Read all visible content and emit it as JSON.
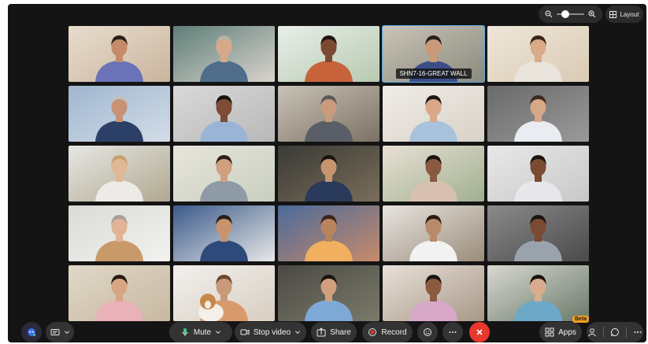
{
  "top_controls": {
    "zoom_level": 0.3,
    "layout_label": "Layout"
  },
  "participants": [
    {
      "shirt": "#6b72b8",
      "skin": "#c48a6a",
      "hair": "#2a1e18",
      "bg": [
        "#e9dccd",
        "#c9b59e"
      ]
    },
    {
      "shirt": "#4f6d8a",
      "skin": "#d6a98a",
      "hair": "#b8b0a8",
      "bg": [
        "#5e7e78",
        "#d9d4cc"
      ]
    },
    {
      "shirt": "#c8643c",
      "skin": "#7a4a32",
      "hair": "#1d1410",
      "bg": [
        "#e8efe9",
        "#b8c9b0"
      ]
    },
    {
      "shirt": "#3b4e8a",
      "skin": "#c89a7a",
      "hair": "#2a201a",
      "bg": [
        "#c9c4b8",
        "#8a8a7c"
      ],
      "room": "SHN7-16-GREAT WALL"
    },
    {
      "shirt": "#e9e4dc",
      "skin": "#d9aa88",
      "hair": "#3a2418",
      "bg": [
        "#efe6d8",
        "#d9cbb4"
      ]
    },
    {
      "shirt": "#2c3f66",
      "skin": "#c89274",
      "hair": "#c0c0c0",
      "bg": [
        "#9fb6cf",
        "#d3dde8"
      ]
    },
    {
      "shirt": "#9ab4d6",
      "skin": "#7c4c34",
      "hair": "#1a1410",
      "bg": [
        "#d9d9d9",
        "#b8b8b8"
      ]
    },
    {
      "shirt": "#5a5e66",
      "skin": "#c99a7c",
      "hair": "#5a5a5a",
      "bg": [
        "#c9c2b6",
        "#7c7264"
      ]
    },
    {
      "shirt": "#a9c2dc",
      "skin": "#d8a888",
      "hair": "#1e1612",
      "bg": [
        "#f0ece6",
        "#d8d2c8"
      ]
    },
    {
      "shirt": "#e9ecf0",
      "skin": "#d6a888",
      "hair": "#3a2a1e",
      "bg": [
        "#6a6a6a",
        "#9a9a9a"
      ]
    },
    {
      "shirt": "#ecebe7",
      "skin": "#e0b898",
      "hair": "#c8a070",
      "bg": [
        "#e6e6e2",
        "#b0a890"
      ]
    },
    {
      "shirt": "#8e9aa6",
      "skin": "#d0a080",
      "hair": "#2e2018",
      "bg": [
        "#e8e4dc",
        "#c8d0c0"
      ]
    },
    {
      "shirt": "#2a3a5a",
      "skin": "#c8946e",
      "hair": "#1a1410",
      "bg": [
        "#3a3a36",
        "#7a6e5a"
      ]
    },
    {
      "shirt": "#d8c0b0",
      "skin": "#8a5a40",
      "hair": "#1a1410",
      "bg": [
        "#e8e0d4",
        "#a0b090"
      ]
    },
    {
      "shirt": "#e8e8ec",
      "skin": "#7a4a32",
      "hair": "#1a1410",
      "bg": [
        "#e8e8e8",
        "#c8c8c8"
      ]
    },
    {
      "shirt": "#c89a6a",
      "skin": "#e0b494",
      "hair": "#a8a098",
      "bg": [
        "#dadad6",
        "#f2f2f0"
      ]
    },
    {
      "shirt": "#2e4a7a",
      "skin": "#c8946e",
      "hair": "#2a1e16",
      "bg": [
        "#3a5a8a",
        "#e8e8e8"
      ]
    },
    {
      "shirt": "#f0b060",
      "skin": "#b8845e",
      "hair": "#3a2416",
      "bg": [
        "#4a6a9a",
        "#c88a6a"
      ]
    },
    {
      "shirt": "#f2f2f2",
      "skin": "#b88a6a",
      "hair": "#2a1e16",
      "bg": [
        "#e8e4e0",
        "#9a8c7a"
      ]
    },
    {
      "shirt": "#9aa2ac",
      "skin": "#7a4a32",
      "hair": "#1a1410",
      "bg": [
        "#8a8a8a",
        "#4a4a4a"
      ]
    },
    {
      "shirt": "#e9b2b8",
      "skin": "#d6a684",
      "hair": "#2a1a12",
      "bg": [
        "#e0d8c8",
        "#c8b8a0"
      ]
    },
    {
      "shirt": "#d89a6a",
      "skin": "#c89a7a",
      "hair": "#6a4a30",
      "bg": [
        "#f2f0ee",
        "#d8cec0"
      ],
      "dog": true
    },
    {
      "shirt": "#7ea8d6",
      "skin": "#d0a07e",
      "hair": "#1a1410",
      "bg": [
        "#4a4a44",
        "#7a7a6a"
      ]
    },
    {
      "shirt": "#d8a8c8",
      "skin": "#8a5a40",
      "hair": "#1a1410",
      "bg": [
        "#e8e0d8",
        "#a89888"
      ]
    },
    {
      "shirt": "#6ea8c8",
      "skin": "#d8ac8c",
      "hair": "#1a1410",
      "bg": [
        "#d8d8d0",
        "#6a7a6a"
      ]
    }
  ],
  "toolbar": {
    "mute_label": "Mute",
    "stop_video_label": "Stop video",
    "share_label": "Share",
    "record_label": "Record",
    "apps_label": "Apps",
    "beta_label": "Beta",
    "icons": {
      "assistant": "ai-assistant-icon",
      "captions": "captions-icon",
      "mic": "microphone-icon",
      "camera": "video-camera-icon",
      "share": "share-icon",
      "record": "record-icon",
      "reactions": "reactions-icon",
      "more": "more-icon",
      "end": "end-call-icon",
      "apps": "apps-icon",
      "participants": "participants-icon",
      "chat": "chat-icon"
    }
  }
}
